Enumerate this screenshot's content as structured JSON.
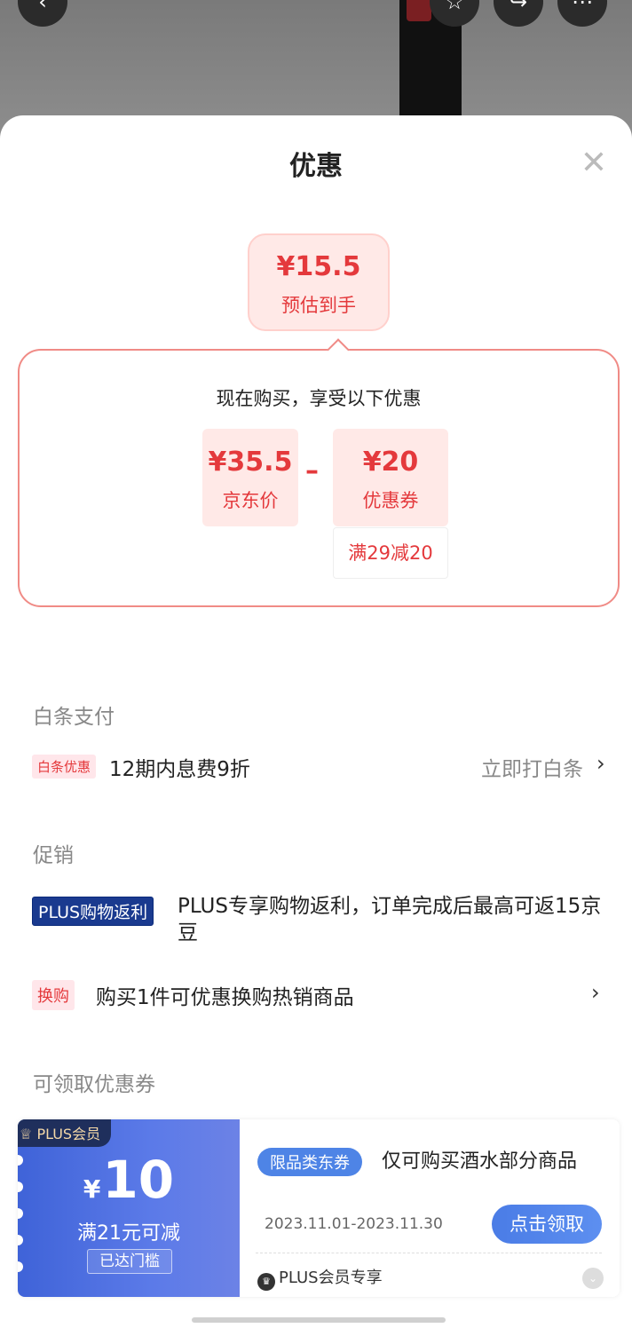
{
  "header": {
    "title": "优惠"
  },
  "estimate": {
    "amount": "¥15.5",
    "label": "预估到手"
  },
  "breakdown": {
    "title": "现在购买，享受以下优惠",
    "price": {
      "value": "¥35.5",
      "label": "京东价"
    },
    "operator": "–",
    "coupon": {
      "value": "¥20",
      "label": "优惠券",
      "rule": "满29减20"
    }
  },
  "baitiao": {
    "section": "白条支付",
    "tag": "白条优惠",
    "text": "12期内息费9折",
    "action": "立即打白条"
  },
  "promotion": {
    "section": "促销",
    "plus_tag": "PLUS购物返利",
    "plus_text": "PLUS专享购物返利，订单完成后最高可返15京豆",
    "swap_tag": "换购",
    "swap_text": "购买1件可优惠换购热销商品"
  },
  "coupons": {
    "section": "可领取优惠券",
    "items": [
      {
        "badge": "PLUS会员",
        "currency": "¥",
        "amount": "10",
        "condition": "满21元可减",
        "threshold": "已达门槛",
        "category_tag": "限品类东券",
        "description": "仅可购买酒水部分商品",
        "dates": "2023.11.01-2023.11.30",
        "button": "点击领取",
        "plus_only": "PLUS会员专享"
      }
    ]
  },
  "colors": {
    "accent_red": "#e4393c",
    "coupon_blue": "#4a7ce6",
    "plus_navy": "#1a3a8f"
  }
}
